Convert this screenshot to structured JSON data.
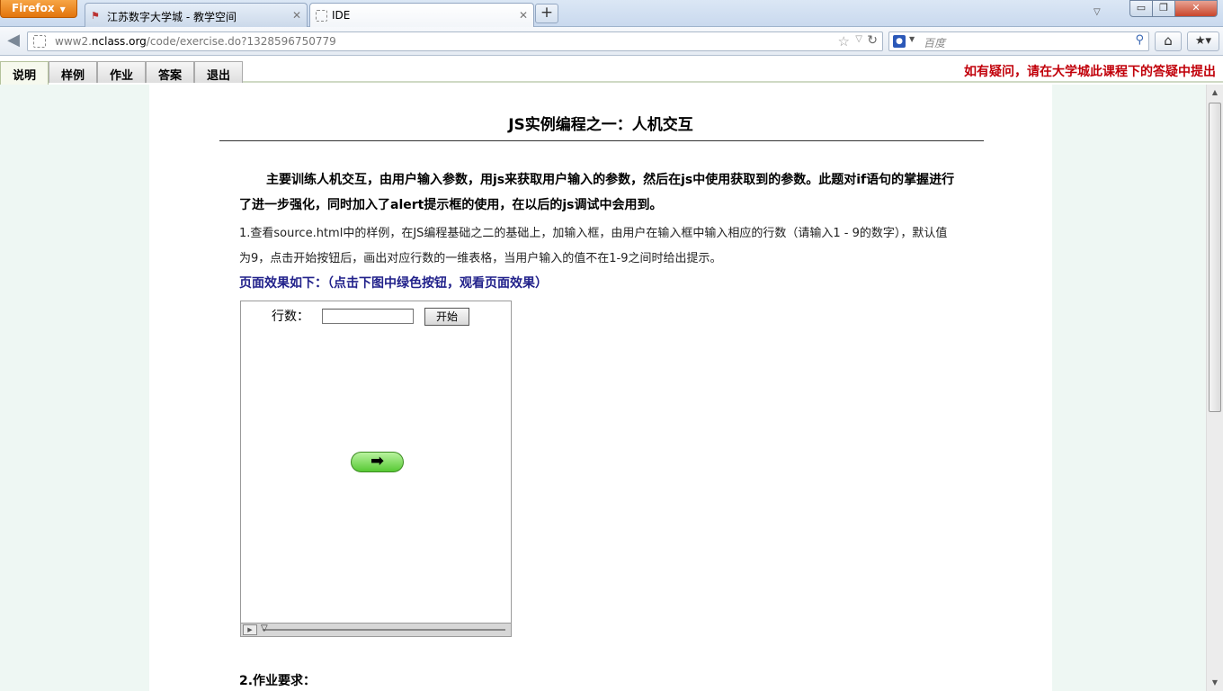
{
  "browser": {
    "menu_button": "Firefox",
    "tabs": [
      {
        "title": "江苏数字大学城 - 教学空间",
        "active": false
      },
      {
        "title": "IDE",
        "active": true
      }
    ],
    "new_tab_label": "+",
    "url": {
      "prefix": "www2.",
      "host": "nclass.org",
      "path": "/code/exercise.do?1328596750779"
    },
    "search_placeholder": "百度",
    "search_engine_icon": "baidu-paw-icon"
  },
  "page": {
    "nav_tabs": [
      "说明",
      "样例",
      "作业",
      "答案",
      "退出"
    ],
    "active_tab": "说明",
    "notice": "如有疑问，请在大学城此课程下的答疑中提出",
    "title": "JS实例编程之一：人机交互",
    "intro": "主要训练人机交互，由用户输入参数，用js来获取用户输入的参数，然后在js中使用获取到的参数。此题对if语句的掌握进行了进一步强化，同时加入了alert提示框的使用，在以后的js调试中会用到。",
    "step1": "1.查看source.html中的样例，在JS编程基础之二的基础上，加输入框，由用户在输入框中输入相应的行数（请输入1 - 9的数字），默认值为9，点击开始按钮后，画出对应行数的一维表格，当用户输入的值不在1-9之间时给出提示。",
    "effect_heading": "页面效果如下：（点击下图中绿色按钮，观看页面效果）",
    "demo": {
      "rows_label": "行数：",
      "rows_value": "",
      "start_button": "开始",
      "play_button_icon": "right-arrow-icon",
      "play_button_glyph": "➡"
    },
    "requirements_heading": "2.作业要求："
  },
  "colors": {
    "notice": "#c1000a",
    "effect_heading": "#22228b",
    "page_background": "#eef7f3",
    "play_button": "#57c934"
  }
}
